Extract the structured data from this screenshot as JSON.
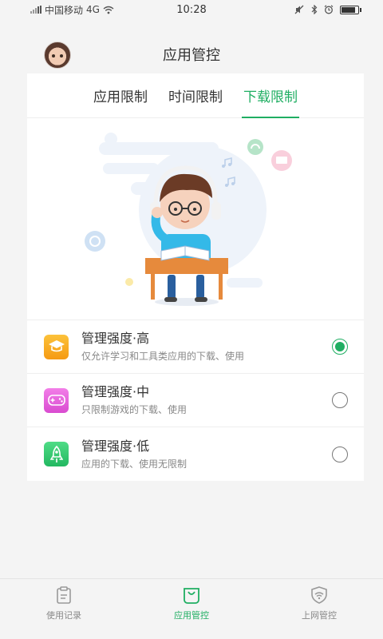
{
  "status_bar": {
    "carrier": "中国移动",
    "network": "4G",
    "time": "10:28",
    "battery_fraction": 0.85
  },
  "header": {
    "title": "应用管控"
  },
  "tabs": [
    {
      "label": "应用限制",
      "active": false
    },
    {
      "label": "时间限制",
      "active": false
    },
    {
      "label": "下载限制",
      "active": true
    }
  ],
  "options": [
    {
      "title": "管理强度·高",
      "desc": "仅允许学习和工具类应用的下载、使用",
      "icon": "graduation-cap-icon",
      "color": "#f7a91b",
      "selected": true
    },
    {
      "title": "管理强度·中",
      "desc": "只限制游戏的下载、使用",
      "icon": "gamepad-icon",
      "color": "#e85fd7",
      "selected": false
    },
    {
      "title": "管理强度·低",
      "desc": "应用的下载、使用无限制",
      "icon": "rocket-icon",
      "color": "#2fc96f",
      "selected": false
    }
  ],
  "bottom_nav": [
    {
      "label": "使用记录",
      "icon": "clipboard-icon",
      "active": false
    },
    {
      "label": "应用管控",
      "icon": "shopping-bag-icon",
      "active": true
    },
    {
      "label": "上网管控",
      "icon": "wifi-shield-icon",
      "active": false
    }
  ],
  "colors": {
    "accent": "#1fae62",
    "background": "#f4f4f4"
  }
}
